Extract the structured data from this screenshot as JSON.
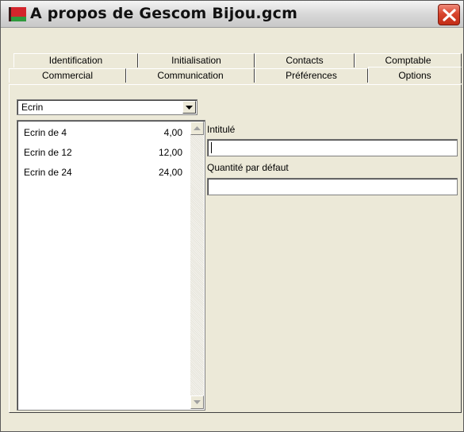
{
  "window": {
    "title": "A propos de Gescom Bijou.gcm",
    "accent_title_bar": "#d8d8d8",
    "close_color": "#d8452e"
  },
  "tabs": {
    "row1": [
      "Identification",
      "Initialisation",
      "Contacts",
      "Comptable"
    ],
    "row2": [
      "Commercial",
      "Communication",
      "Préférences",
      "Options"
    ],
    "active": "Options"
  },
  "options_page": {
    "category_combo": {
      "selected": "Ecrin"
    },
    "items": [
      {
        "label": "Ecrin de 4",
        "value": "4,00"
      },
      {
        "label": "Ecrin de 12",
        "value": "12,00"
      },
      {
        "label": "Ecrin de 24",
        "value": "24,00"
      }
    ],
    "fields": {
      "intitule_label": "Intitulé",
      "intitule_value": "",
      "quantite_label": "Quantité par défaut",
      "quantite_value": ""
    }
  }
}
